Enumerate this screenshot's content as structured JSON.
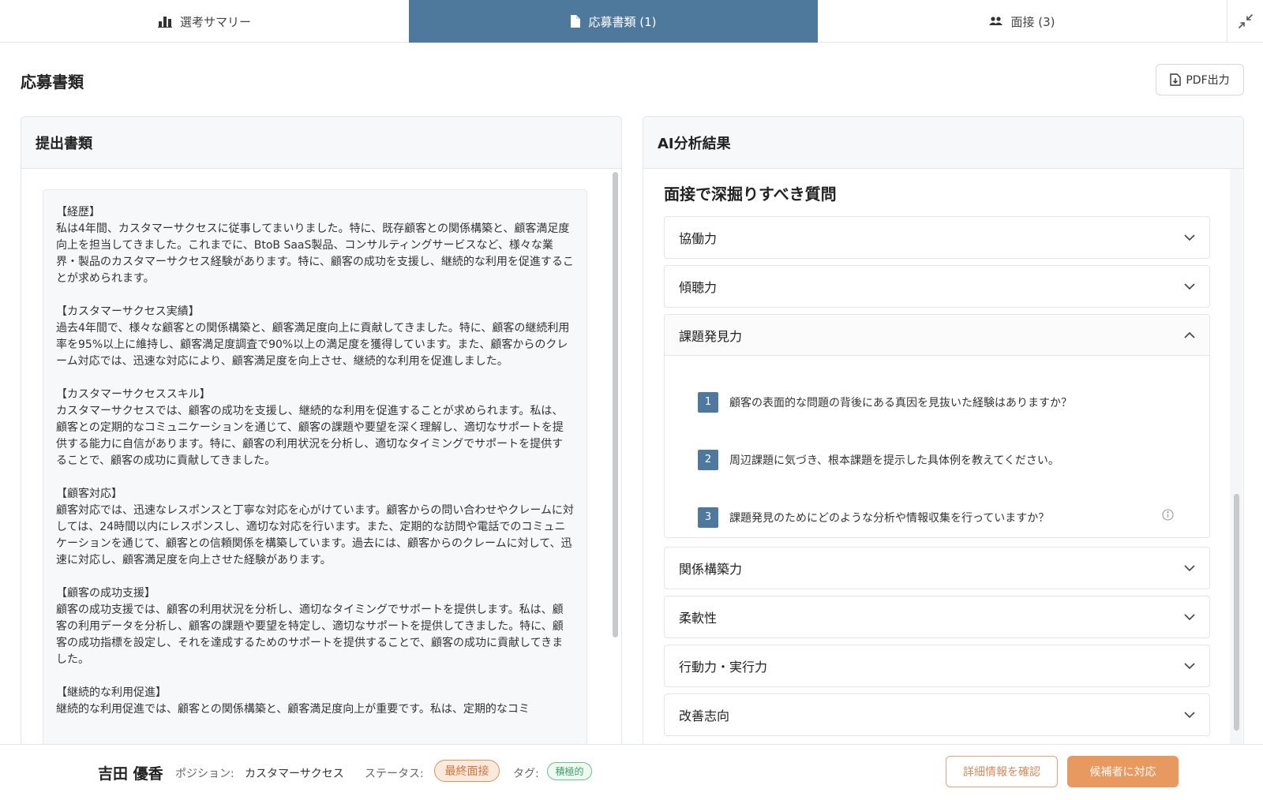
{
  "tabs": [
    {
      "label": "選考サマリー",
      "icon": "bar-chart-icon"
    },
    {
      "label": "応募書類 (1)",
      "icon": "document-icon"
    },
    {
      "label": "面接 (3)",
      "icon": "users-icon"
    }
  ],
  "header": {
    "title": "応募書類",
    "pdf_label": "PDF出力"
  },
  "left_panel": {
    "title": "提出書類",
    "sections": [
      {
        "title": "【経歴】",
        "body": "私は4年間、カスタマーサクセスに従事してまいりました。特に、既存顧客との関係構築と、顧客満足度向上を担当してきました。これまでに、BtoB SaaS製品、コンサルティングサービスなど、様々な業界・製品のカスタマーサクセス経験があります。特に、顧客の成功を支援し、継続的な利用を促進することが求められます。"
      },
      {
        "title": "【カスタマーサクセス実績】",
        "body": "過去4年間で、様々な顧客との関係構築と、顧客満足度向上に貢献してきました。特に、顧客の継続利用率を95%以上に維持し、顧客満足度調査で90%以上の満足度を獲得しています。また、顧客からのクレーム対応では、迅速な対応により、顧客満足度を向上させ、継続的な利用を促進しました。"
      },
      {
        "title": "【カスタマーサクセススキル】",
        "body": "カスタマーサクセスでは、顧客の成功を支援し、継続的な利用を促進することが求められます。私は、顧客との定期的なコミュニケーションを通じて、顧客の課題や要望を深く理解し、適切なサポートを提供する能力に自信があります。特に、顧客の利用状況を分析し、適切なタイミングでサポートを提供することで、顧客の成功に貢献してきました。"
      },
      {
        "title": "【顧客対応】",
        "body": "顧客対応では、迅速なレスポンスと丁寧な対応を心がけています。顧客からの問い合わせやクレームに対しては、24時間以内にレスポンスし、適切な対応を行います。また、定期的な訪問や電話でのコミュニケーションを通じて、顧客との信頼関係を構築しています。過去には、顧客からのクレームに対して、迅速に対応し、顧客満足度を向上させた経験があります。"
      },
      {
        "title": "【顧客の成功支援】",
        "body": "顧客の成功支援では、顧客の利用状況を分析し、適切なタイミングでサポートを提供します。私は、顧客の利用データを分析し、顧客の課題や要望を特定し、適切なサポートを提供してきました。特に、顧客の成功指標を設定し、それを達成するためのサポートを提供することで、顧客の成功に貢献してきました。"
      },
      {
        "title": "【継続的な利用促進】",
        "body": "継続的な利用促進では、顧客との関係構築と、顧客満足度向上が重要です。私は、定期的なコミ"
      }
    ]
  },
  "right_panel": {
    "title": "AI分析結果",
    "subtitle": "面接で深掘りすべき質問",
    "accordions": [
      {
        "label": "協働力",
        "open": false
      },
      {
        "label": "傾聴力",
        "open": false
      },
      {
        "label": "課題発見力",
        "open": true,
        "questions": [
          {
            "num": "1",
            "text": "顧客の表面的な問題の背後にある真因を見抜いた経験はありますか？"
          },
          {
            "num": "2",
            "text": "周辺課題に気づき、根本課題を提示した具体例を教えてください。"
          },
          {
            "num": "3",
            "text": "課題発見のためにどのような分析や情報収集を行っていますか？"
          }
        ]
      },
      {
        "label": "関係構築力",
        "open": false
      },
      {
        "label": "柔軟性",
        "open": false
      },
      {
        "label": "行動力・実行力",
        "open": false
      },
      {
        "label": "改善志向",
        "open": false
      }
    ]
  },
  "footer": {
    "name": "吉田 優香",
    "position_label": "ポジション:",
    "position_value": "カスタマーサクセス",
    "status_label": "ステータス:",
    "status_value": "最終面接",
    "tag_label": "タグ:",
    "tag_value": "積極的",
    "detail_button": "詳細情報を確認",
    "respond_button": "候補者に対応"
  },
  "colors": {
    "accent": "#4e789c",
    "orange": "#e7995f",
    "green": "#3c9d6a"
  }
}
